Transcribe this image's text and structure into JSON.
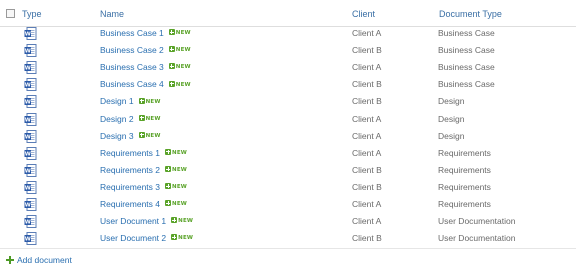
{
  "columns": {
    "type": "Type",
    "name": "Name",
    "client": "Client",
    "doctype": "Document Type"
  },
  "new_badge": "NEW",
  "rows": [
    {
      "name": "Business Case 1",
      "client": "Client A",
      "doctype": "Business Case",
      "icon": "word-document-icon"
    },
    {
      "name": "Business Case 2",
      "client": "Client B",
      "doctype": "Business Case",
      "icon": "word-document-icon"
    },
    {
      "name": "Business Case 3",
      "client": "Client A",
      "doctype": "Business Case",
      "icon": "word-document-icon"
    },
    {
      "name": "Business Case 4",
      "client": "Client B",
      "doctype": "Business Case",
      "icon": "word-document-icon"
    },
    {
      "name": "Design 1",
      "client": "Client B",
      "doctype": "Design",
      "icon": "word-document-icon"
    },
    {
      "name": "Design 2",
      "client": "Client A",
      "doctype": "Design",
      "icon": "word-document-icon"
    },
    {
      "name": "Design 3",
      "client": "Client A",
      "doctype": "Design",
      "icon": "word-document-icon"
    },
    {
      "name": "Requirements 1",
      "client": "Client A",
      "doctype": "Requirements",
      "icon": "word-document-icon"
    },
    {
      "name": "Requirements 2",
      "client": "Client B",
      "doctype": "Requirements",
      "icon": "word-document-icon"
    },
    {
      "name": "Requirements 3",
      "client": "Client B",
      "doctype": "Requirements",
      "icon": "word-document-icon"
    },
    {
      "name": "Requirements 4",
      "client": "Client A",
      "doctype": "Requirements",
      "icon": "word-document-icon"
    },
    {
      "name": "User Document 1",
      "client": "Client A",
      "doctype": "User Documentation",
      "icon": "word-document-icon"
    },
    {
      "name": "User Document 2",
      "client": "Client B",
      "doctype": "User Documentation",
      "icon": "word-document-icon"
    }
  ],
  "footer": {
    "add_label": "Add document"
  },
  "colors": {
    "link": "#2a6fb0",
    "header": "#3a6fa5",
    "new_badge": "#5aa329",
    "text": "#6a6a6a"
  }
}
